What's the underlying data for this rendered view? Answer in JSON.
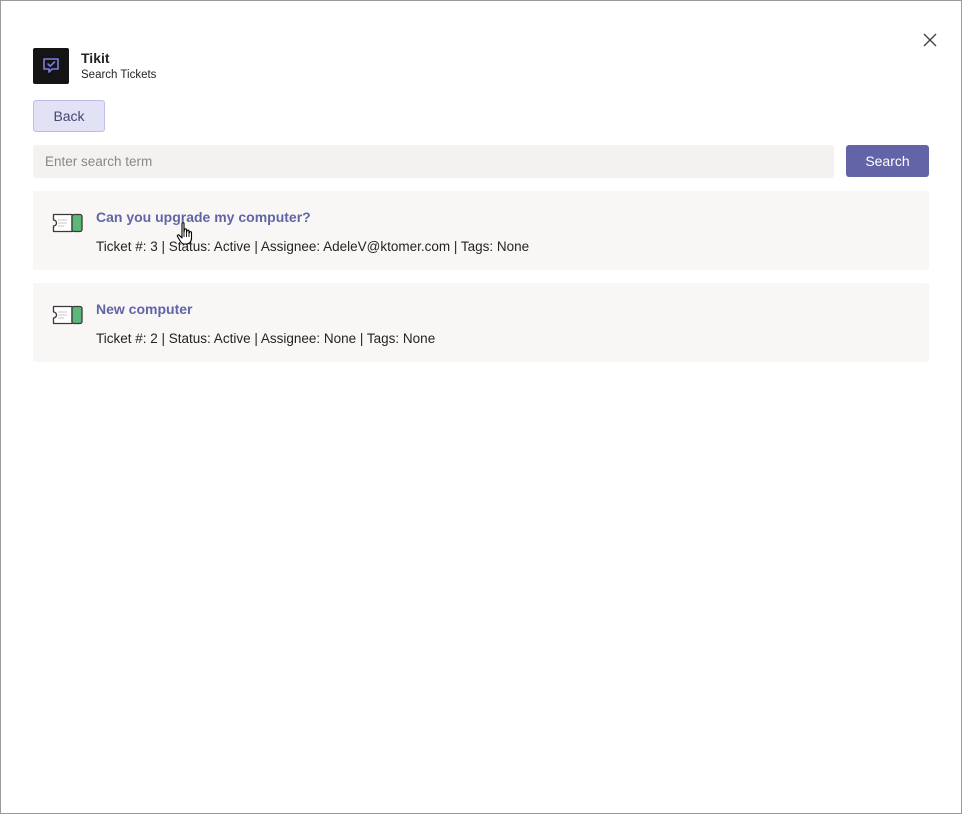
{
  "app": {
    "name": "Tikit",
    "subtitle": "Search Tickets"
  },
  "toolbar": {
    "back_label": "Back",
    "search_label": "Search"
  },
  "search": {
    "placeholder": "Enter search term",
    "value": ""
  },
  "tickets": [
    {
      "title": "Can you upgrade my computer?",
      "meta": "Ticket #: 3 | Status: Active | Assignee: AdeleV@ktomer.com | Tags: None"
    },
    {
      "title": "New computer",
      "meta": "Ticket #: 2 | Status: Active | Assignee: None | Tags: None"
    }
  ],
  "colors": {
    "accent": "#6264a7",
    "back_button_bg": "#e1e2f5",
    "card_bg": "#f8f7f5",
    "ticket_green": "#5cb879"
  },
  "icons": {
    "close": "close-icon",
    "logo": "tikit-logo-icon",
    "ticket": "ticket-icon",
    "cursor": "hand-pointer-cursor"
  }
}
